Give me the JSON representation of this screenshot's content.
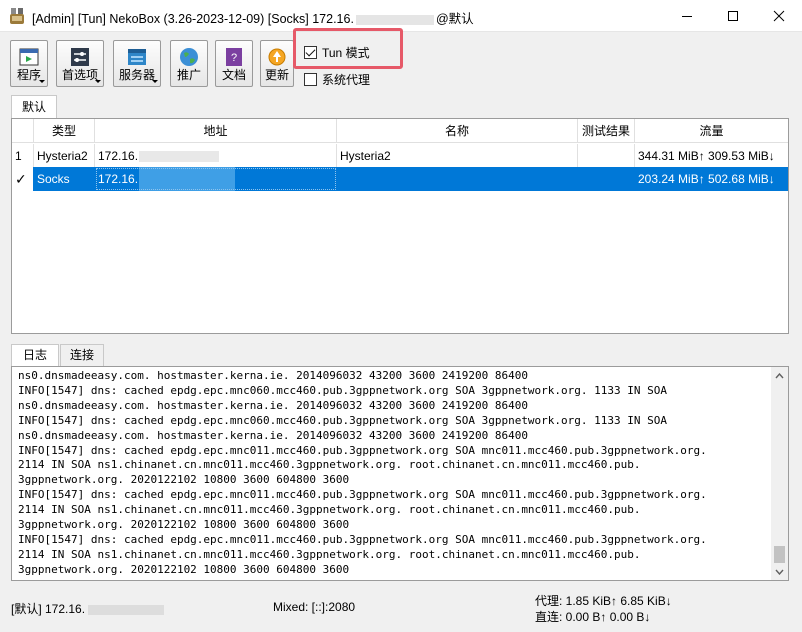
{
  "window": {
    "title_prefix": "[Admin] [Tun] NekoBox (3.26-2023-12-09) [Socks] 172.16.",
    "title_suffix": "@默认",
    "minimize": "minimize",
    "maximize": "maximize",
    "close": "close"
  },
  "toolbar": {
    "buttons": [
      {
        "label": "程序",
        "icon": "program-icon",
        "dropdown": true
      },
      {
        "label": "首选项",
        "icon": "preferences-icon",
        "dropdown": true
      },
      {
        "label": "服务器",
        "icon": "server-icon",
        "dropdown": true
      },
      {
        "label": "推广",
        "icon": "globe-icon",
        "dropdown": false
      },
      {
        "label": "文档",
        "icon": "docs-icon",
        "dropdown": false
      },
      {
        "label": "更新",
        "icon": "update-icon",
        "dropdown": false
      }
    ],
    "tun_mode": {
      "label": "Tun 模式",
      "checked": true
    },
    "system_proxy": {
      "label": "系统代理",
      "checked": false
    }
  },
  "group_tab": "默认",
  "table": {
    "headers": [
      "类型",
      "地址",
      "名称",
      "测试结果",
      "流量"
    ],
    "rows": [
      {
        "index": "1",
        "type": "Hysteria2",
        "address": "172.16.",
        "name": "Hysteria2",
        "test": "",
        "traffic": "344.31 MiB↑ 309.53 MiB↓",
        "selected": false
      },
      {
        "index": "✓",
        "type": "Socks",
        "address": "172.16.",
        "name": "",
        "test": "",
        "traffic": "203.24 MiB↑ 502.68 MiB↓",
        "selected": true
      }
    ]
  },
  "bottom_tabs": [
    "日志",
    "连接"
  ],
  "log_lines": [
    "ns0.dnsmadeeasy.com. hostmaster.kerna.ie. 2014096032 43200 3600 2419200 86400",
    "INFO[1547] dns: cached epdg.epc.mnc060.mcc460.pub.3gppnetwork.org SOA 3gppnetwork.org. 1133 IN SOA",
    "ns0.dnsmadeeasy.com. hostmaster.kerna.ie. 2014096032 43200 3600 2419200 86400",
    "INFO[1547] dns: cached epdg.epc.mnc060.mcc460.pub.3gppnetwork.org SOA 3gppnetwork.org. 1133 IN SOA",
    "ns0.dnsmadeeasy.com. hostmaster.kerna.ie. 2014096032 43200 3600 2419200 86400",
    "INFO[1547] dns: cached epdg.epc.mnc011.mcc460.pub.3gppnetwork.org SOA mnc011.mcc460.pub.3gppnetwork.org.",
    "2114 IN SOA ns1.chinanet.cn.mnc011.mcc460.3gppnetwork.org. root.chinanet.cn.mnc011.mcc460.pub.",
    "3gppnetwork.org. 2020122102 10800 3600 604800 3600",
    "INFO[1547] dns: cached epdg.epc.mnc011.mcc460.pub.3gppnetwork.org SOA mnc011.mcc460.pub.3gppnetwork.org.",
    "2114 IN SOA ns1.chinanet.cn.mnc011.mcc460.3gppnetwork.org. root.chinanet.cn.mnc011.mcc460.pub.",
    "3gppnetwork.org. 2020122102 10800 3600 604800 3600",
    "INFO[1547] dns: cached epdg.epc.mnc011.mcc460.pub.3gppnetwork.org SOA mnc011.mcc460.pub.3gppnetwork.org.",
    "2114 IN SOA ns1.chinanet.cn.mnc011.mcc460.3gppnetwork.org. root.chinanet.cn.mnc011.mcc460.pub.",
    "3gppnetwork.org. 2020122102 10800 3600 604800 3600"
  ],
  "status": {
    "group_ip": "[默认] 172.16.",
    "mixed": "Mixed: [::]:2080",
    "proxy_speed": "代理: 1.85 KiB↑ 6.85 KiB↓",
    "direct_speed": "直连: 0.00 B↑ 0.00 B↓"
  },
  "colors": {
    "selection": "#0078d7",
    "highlight_box": "#e65968"
  }
}
